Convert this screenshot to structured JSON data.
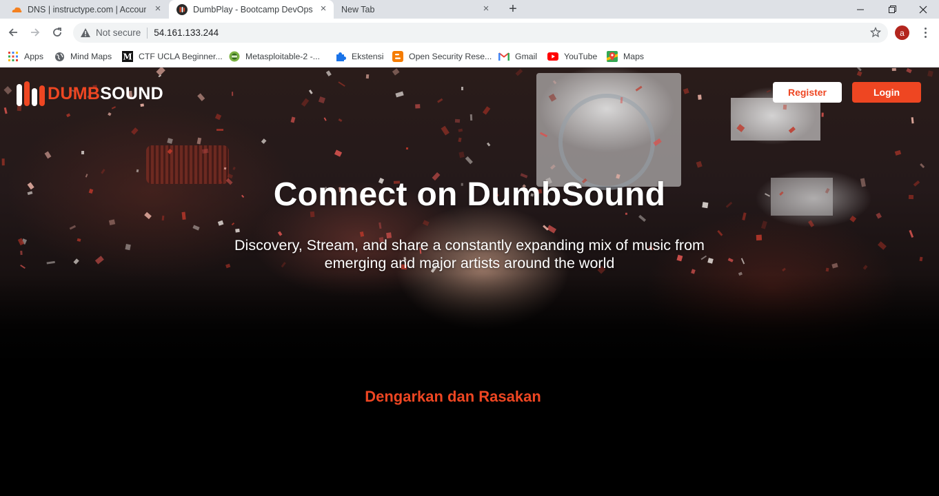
{
  "browser": {
    "tabs": [
      {
        "title": "DNS | instructype.com | Account"
      },
      {
        "title": "DumbPlay - Bootcamp DevOps"
      },
      {
        "title": "New Tab"
      }
    ],
    "new_tab_symbol": "+",
    "window_controls": {
      "minimize": "—",
      "maximize": "❐",
      "close": "✕"
    },
    "security_label": "Not secure",
    "url": "54.161.133.244",
    "profile_initial": "a",
    "bookmarks": [
      {
        "label": "Apps",
        "icon": "apps-grid-icon"
      },
      {
        "label": "Mind Maps",
        "icon": "globe-icon"
      },
      {
        "label": "CTF UCLA Beginner...",
        "icon": "medium-icon"
      },
      {
        "label": "Metasploitable-2 -...",
        "icon": "metasploit-icon"
      },
      {
        "label": "Ekstensi",
        "icon": "puzzle-icon"
      },
      {
        "label": "Open Security Rese...",
        "icon": "blogger-icon"
      },
      {
        "label": "Gmail",
        "icon": "gmail-icon"
      },
      {
        "label": "YouTube",
        "icon": "youtube-icon"
      },
      {
        "label": "Maps",
        "icon": "maps-icon"
      }
    ]
  },
  "site": {
    "logo": {
      "part1": "DUMB",
      "part2": "SOUND"
    },
    "nav": {
      "register": "Register",
      "login": "Login"
    },
    "hero": {
      "title": "Connect on DumbSound",
      "subtitle": "Discovery, Stream, and share a constantly expanding mix of music from emerging and major artists around the world"
    },
    "section_title": "Dengarkan dan Rasakan",
    "colors": {
      "accent": "#ee4622",
      "background": "#000000"
    }
  }
}
